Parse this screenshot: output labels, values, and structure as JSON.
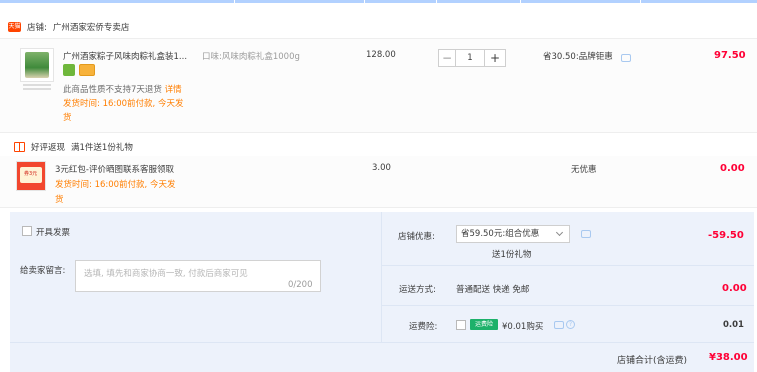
{
  "shop": {
    "badge": "天猫",
    "label": "店铺:",
    "name": "广州酒家宏侨专卖店"
  },
  "item": {
    "title": "广州酒家粽子风味肉粽礼盒装1...",
    "sku": "口味:风味肉粽礼盒1000g",
    "return_notice": "此商品性质不支持7天退货",
    "return_detail": "详情",
    "ship_line1": "发货时间: 16:00前付款, 今天发",
    "ship_line2": "货",
    "unit_price": "128.00",
    "quantity": "1",
    "minus": "−",
    "plus": "+",
    "discount": "省30.50:品牌钜惠",
    "subtotal": "97.50"
  },
  "gift": {
    "header": "好评返现",
    "promo": "满1件送1份礼物",
    "thumb_text": "券3元",
    "title": "3元红包-评价晒图联系客服领取",
    "ship_line1": "发货时间: 16:00前付款, 今天发",
    "ship_line2": "货",
    "price": "3.00",
    "discount": "无优惠",
    "subtotal": "0.00"
  },
  "options": {
    "invoice_label": "开具发票",
    "message_label": "给卖家留言:",
    "message_placeholder": "选填, 填先和商家协商一致, 付款后商家可见",
    "message_counter": "0/200",
    "shop_discount_label": "店铺优惠:",
    "shop_discount_value": "省59.50元:组合优惠",
    "shop_discount_note": "送1份礼物",
    "shop_discount_amount": "-59.50",
    "shipping_label": "运送方式:",
    "shipping_value": "普通配送 快递 免邮",
    "shipping_amount": "0.00",
    "insurance_label": "运费险:",
    "insurance_badge": "运费险",
    "insurance_value": "¥0.01购买",
    "insurance_amount": "0.01",
    "total_label": "店铺合计(含运费)",
    "total_amount": "¥38.00"
  }
}
